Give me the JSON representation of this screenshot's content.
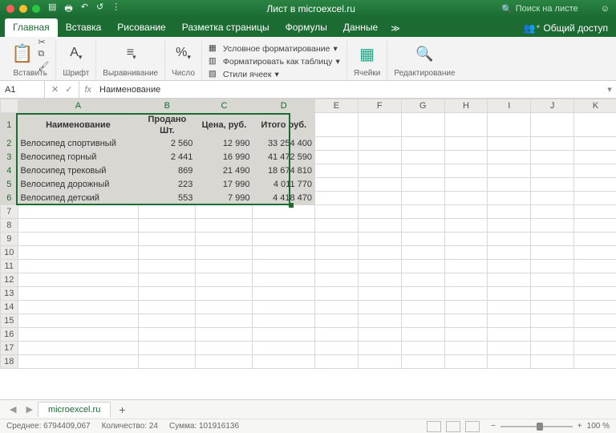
{
  "titlebar": {
    "title": "Лист в microexcel.ru",
    "search_placeholder": "Поиск на листе"
  },
  "tabs": {
    "items": [
      "Главная",
      "Вставка",
      "Рисование",
      "Разметка страницы",
      "Формулы",
      "Данные"
    ],
    "more": "≫",
    "share": "Общий доступ"
  },
  "ribbon": {
    "paste": "Вставить",
    "font": "Шрифт",
    "align": "Выравнивание",
    "number": "Число",
    "cond_fmt": "Условное форматирование",
    "as_table": "Форматировать как таблицу",
    "cell_styles": "Стили ячеек",
    "cells": "Ячейки",
    "editing": "Редактирование"
  },
  "formula_bar": {
    "namebox": "A1",
    "value": "Наименование"
  },
  "columns": [
    "A",
    "B",
    "C",
    "D",
    "E",
    "F",
    "G",
    "H",
    "I",
    "J",
    "K"
  ],
  "row_count": 18,
  "headers": [
    "Наименование",
    "Продано Шт.",
    "Цена, руб.",
    "Итого руб."
  ],
  "rows": [
    [
      "Велосипед спортивный",
      "2 560",
      "12 990",
      "33 254 400"
    ],
    [
      "Велосипед горный",
      "2 441",
      "16 990",
      "41 472 590"
    ],
    [
      "Велосипед трековый",
      "869",
      "21 490",
      "18 674 810"
    ],
    [
      "Велосипед дорожный",
      "223",
      "17 990",
      "4 011 770"
    ],
    [
      "Велосипед детский",
      "553",
      "7 990",
      "4 418 470"
    ]
  ],
  "sheet_tab": "microexcel.ru",
  "status": {
    "avg_label": "Среднее:",
    "avg_val": "6794409,067",
    "count_label": "Количество:",
    "count_val": "24",
    "sum_label": "Сумма:",
    "sum_val": "101916136",
    "zoom": "100 %"
  }
}
